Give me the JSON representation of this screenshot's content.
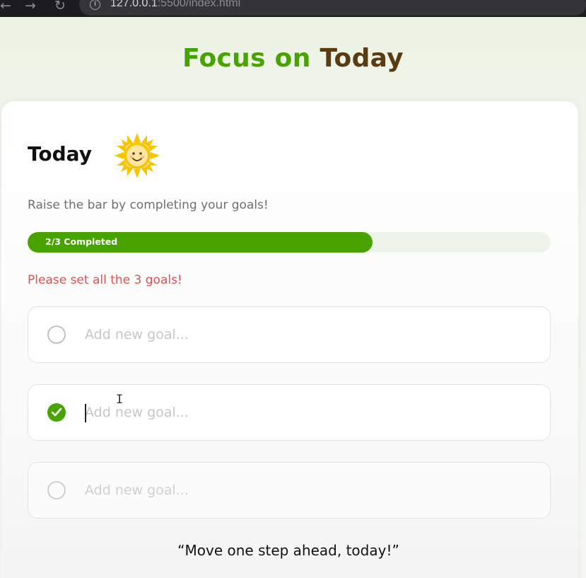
{
  "browser": {
    "nav_back": "←",
    "nav_forward": "→",
    "nav_reload": "↻",
    "url_host": "127.0.0.1",
    "url_port_path": ":5500/index.html"
  },
  "app": {
    "title_accent": "Focus on",
    "title_rest": "Today"
  },
  "card": {
    "title": "Today",
    "subtitle": "Raise the bar by completing your goals!",
    "progress": {
      "label": "2/3 Completed",
      "fraction": 0.66
    },
    "error": "Please set all the 3 goals!",
    "goals": [
      {
        "placeholder": "Add new goal...",
        "value": "",
        "completed": false
      },
      {
        "placeholder": "Add new goal...",
        "value": "",
        "completed": true
      },
      {
        "placeholder": "Add new goal...",
        "value": "",
        "completed": false
      }
    ],
    "quote": "“Move one step ahead, today!”"
  },
  "colors": {
    "accent": "#48a300",
    "title_dark": "#5a3b12",
    "error": "#e0504f",
    "sun": "#f6c400"
  },
  "icons": {
    "sun": "sun-icon",
    "check": "check-icon"
  }
}
